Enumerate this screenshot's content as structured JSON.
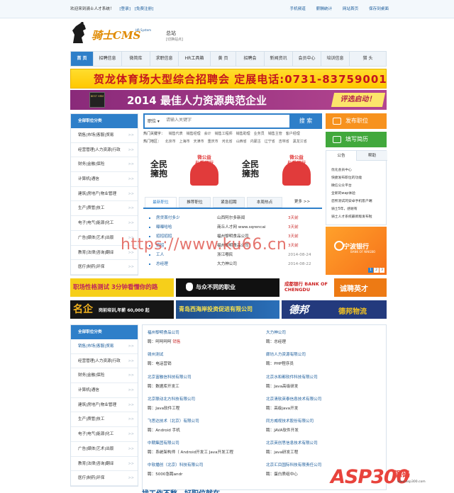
{
  "topbar": {
    "welcome": "欢迎来到骑士人才系统！",
    "login": "[登录]",
    "register": "[免费注册]",
    "links": [
      "手机频道",
      "薪酬统计",
      "网站首页",
      "保存到桌面"
    ]
  },
  "logo": {
    "name": "骑士CMS",
    "sub": "HR System"
  },
  "site": {
    "title": "总站",
    "switch": "[切换站点]"
  },
  "nav": [
    "首 页",
    "招聘信息",
    "微简库",
    "求职信息",
    "HR工具箱",
    "黄 页",
    "招聘会",
    "新闻资讯",
    "会员中心",
    "培训信息",
    "猎 头"
  ],
  "banner1": "贺龙体育场大型综合招聘会 定展电话:0731-83759001",
  "banner2": {
    "badge": "BEST HRM",
    "text": "2014 最佳人力资源典范企业",
    "cta": "评选启动！"
  },
  "sidebar": {
    "title": "全部职位分类",
    "items": [
      "销售|市场|客服|贸易",
      "经营管理|人力资源|行政",
      "财务|金融|保险",
      "计算机|通信",
      "建筑|房地产|物业管理",
      "生产|质管|技工",
      "电子|电气|能源|化工",
      "广告|媒体|艺术|出版",
      "教育|法律|咨询|翻译",
      "医疗|制药|环保"
    ]
  },
  "search": {
    "select": "职位 ▾",
    "placeholder": "请输入关键字",
    "button": "搜 索"
  },
  "hot_keywords": {
    "label": "热门关键字：",
    "items": [
      "销售代表",
      "销售经理",
      "会计",
      "销售工程师",
      "销售助理",
      "业务员",
      "销售主管",
      "客户经理"
    ]
  },
  "hot_areas": {
    "label": "热门地区：",
    "items": [
      "北京市",
      "上海市",
      "天津市",
      "重庆市",
      "河北省",
      "山西省",
      "内蒙古",
      "辽宁省",
      "吉林省",
      "黑龙江省"
    ]
  },
  "actions": {
    "post_job": "发布职位",
    "fill_resume": "填写简历"
  },
  "promo": [
    {
      "type": "fm",
      "text": "全民\n擁抱"
    },
    {
      "type": "gh",
      "text": "微公益\n与爱同行"
    },
    {
      "type": "fm",
      "text": "全民\n擁抱"
    },
    {
      "type": "gh",
      "text": "微公益\n与爱同行"
    }
  ],
  "job_tabs": [
    "最新职位",
    "推荐职位",
    "紧急招聘",
    "本周热点",
    "更多 >>"
  ],
  "jobs": [
    {
      "title": "房贷首付多少",
      "company": "山西阿尔多新闻",
      "time": "3天前"
    },
    {
      "title": "曝曝哈哈",
      "company": "商丘人才网 www.sqrencai",
      "time": "3天前"
    },
    {
      "title": "招招招招",
      "company": "福州黎明食品公司",
      "time": "3天前"
    },
    {
      "title": "招招",
      "company": "福州黎明食品公司",
      "time": "3天前"
    },
    {
      "title": "工人",
      "company": "浙江嘟民",
      "time": "2014-08-24"
    },
    {
      "title": "总经理",
      "company": "大力神公司",
      "time": "2014-08-22"
    }
  ],
  "notice": {
    "tabs": [
      "公告",
      "帮助"
    ],
    "items": [
      "优化会员中心",
      "快捷发布职位的功能",
      "微信公众平台",
      "全新的wap体验",
      "您所测试的安卓手机客户端",
      "骑士5年，感谢有",
      "骑士人才系统最新版发布啦"
    ]
  },
  "bank": {
    "name": "宁波银行",
    "en": "BANK OF NINGBO",
    "pages": [
      "1",
      "2",
      "3"
    ]
  },
  "ads": [
    {
      "text": "职场性格测试 3分钟看懂你的路"
    },
    {
      "text": "与众不同的职业"
    },
    {
      "text": "成都银行 BANK OF CHENGDU"
    },
    {
      "text": "诚聘英才"
    },
    {
      "text": "名企"
    },
    {
      "text": "岗前培训,年薪 60,000 起"
    },
    {
      "text": "青岛西海岸投资促进有限公司"
    },
    {
      "text": "德邦"
    },
    {
      "text": "德邦物流"
    }
  ],
  "companies": [
    {
      "name": "福州黎明食品公司",
      "prefix": "聘：",
      "jobs": "呵呵呵呵",
      "hot": "销售"
    },
    {
      "name": "大力神公司",
      "prefix": "聘：",
      "jobs": "总经理",
      "hot": ""
    },
    {
      "name": "赣州测试",
      "prefix": "聘：",
      "jobs": "电话营销",
      "hot": ""
    },
    {
      "name": "廊坊人力资源有限公司",
      "prefix": "聘：",
      "jobs": "PHP程序员",
      "hot": ""
    },
    {
      "name": "北京富融信科技有限公司",
      "prefix": "聘：",
      "jobs": "数据库开发工",
      "hot": ""
    },
    {
      "name": "北京水和都软件科技有限公司",
      "prefix": "聘：",
      "jobs": "Java高级研发",
      "hot": ""
    },
    {
      "name": "北京联动北方科技有限公司",
      "prefix": "聘：",
      "jobs": "Java软件工程",
      "hot": ""
    },
    {
      "name": "北京清软英泰信息技术有限公司",
      "prefix": "聘：",
      "jobs": "高级java开发",
      "hot": ""
    },
    {
      "name": "飞思达技术（北京）有限公司",
      "prefix": "聘：",
      "jobs": "Android 手机",
      "hot": ""
    },
    {
      "name": "同方威视技术股份有限公司",
      "prefix": "聘：",
      "jobs": "JAVA软件开发",
      "hot": ""
    },
    {
      "name": "中期集团有限公司",
      "prefix": "聘：",
      "jobs": "系统架构师（ Android开发工 Java开发工程",
      "hot": ""
    },
    {
      "name": "北京英创思信息技术有限公司",
      "prefix": "聘：",
      "jobs": "java研发工程",
      "hot": ""
    },
    {
      "name": "中软播创（北京）科技有限公司",
      "prefix": "聘：",
      "jobs": "5000急聘andr",
      "hot": ""
    },
    {
      "name": "北京汇目国际科技有限责任公司",
      "prefix": "聘：",
      "jobs": "蛋白质组中心",
      "hot": ""
    }
  ],
  "watermark": "https://www.ku66.cn",
  "footer_partial": "找工作不愁，好职位就在 ...",
  "asp_logo": {
    "main": "ASP300",
    "sub": "源码",
    "url": "www.asp300.com"
  }
}
